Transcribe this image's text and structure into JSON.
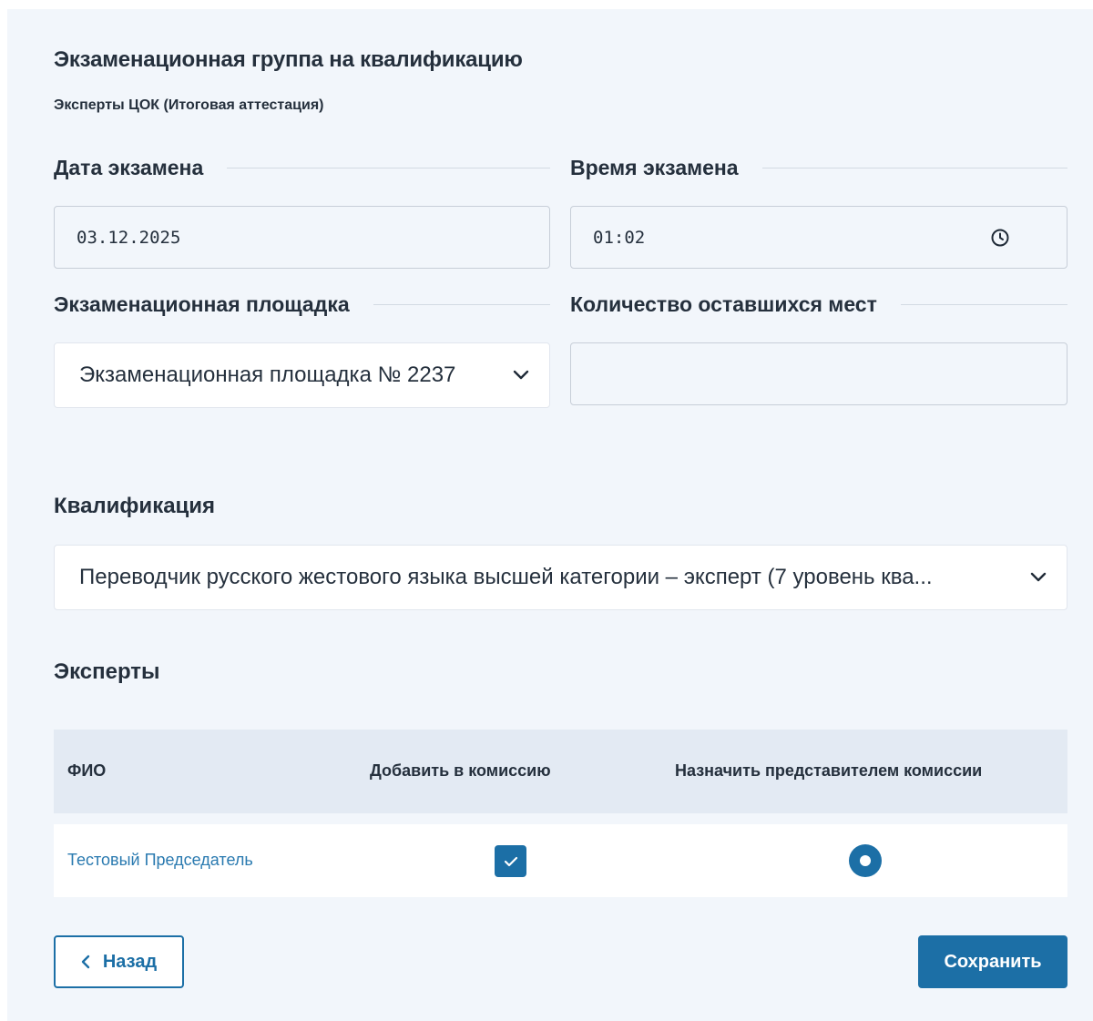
{
  "form": {
    "title": "Экзаменационная группа на квалификацию",
    "subtitle": "Эксперты ЦОК (Итоговая аттестация)"
  },
  "fields": {
    "exam_date": {
      "label": "Дата экзамена",
      "value": "03.12.2025"
    },
    "exam_time": {
      "label": "Время экзамена",
      "value": "01:02",
      "icon": "clock-icon"
    },
    "exam_site": {
      "label": "Экзаменационная площадка",
      "value": "Экзаменационная площадка № 2237",
      "icon": "chevron-down-icon"
    },
    "seats_left": {
      "label": "Количество оставшихся мест",
      "value": ""
    }
  },
  "qualification": {
    "label": "Квалификация",
    "value": "Переводчик русского жестового языка высшей категории – эксперт (7 уровень ква...",
    "icon": "chevron-down-icon"
  },
  "experts": {
    "label": "Эксперты",
    "columns": [
      "ФИО",
      "Добавить в комиссию",
      "Назначить представителем комиссии"
    ],
    "rows": [
      {
        "name": "Тестовый Председатель",
        "added": true,
        "representative": true
      }
    ]
  },
  "actions": {
    "back_label": "Назад",
    "save_label": "Сохранить"
  },
  "colors": {
    "accent": "#1c6fa6",
    "background": "#f2f6fb",
    "table_header": "#e3eaf3",
    "link": "#2a7ab0"
  }
}
